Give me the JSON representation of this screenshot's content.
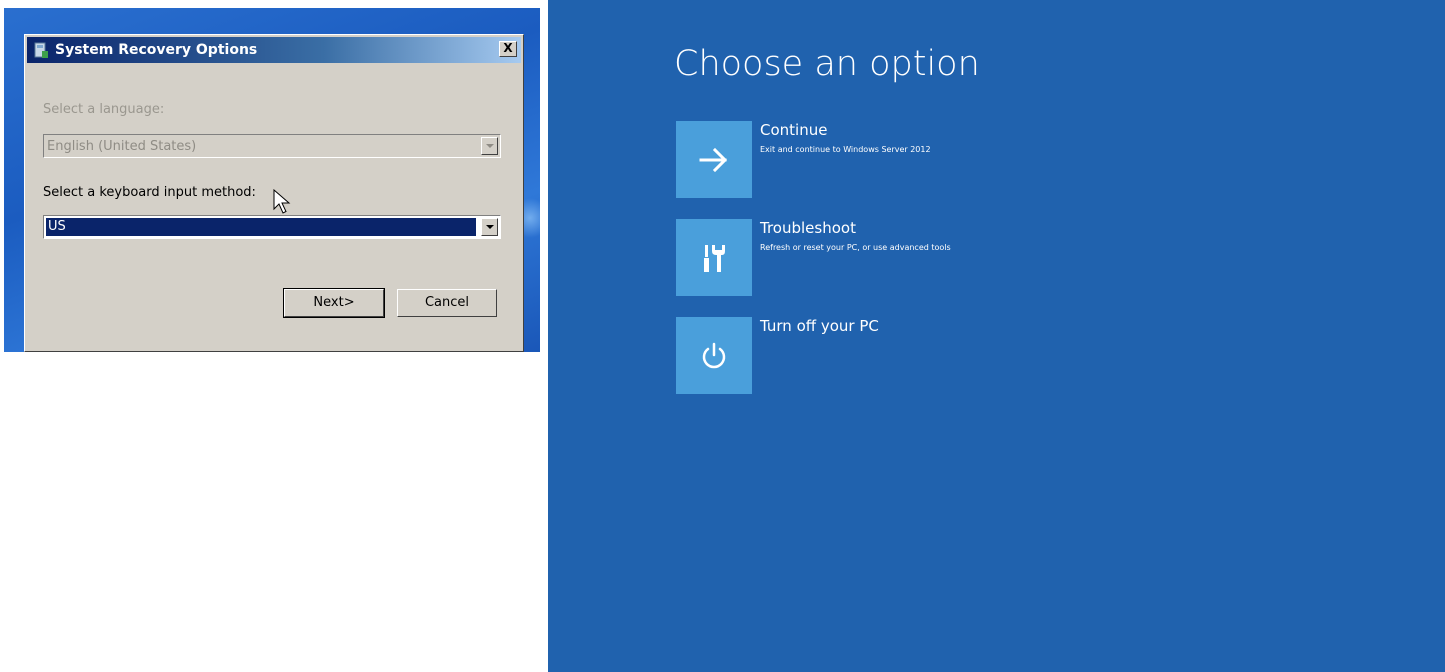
{
  "dialog": {
    "title": "System Recovery Options",
    "close_label": "X",
    "language_label": "Select a language:",
    "language_value": "English (United States)",
    "keyboard_label": "Select a keyboard input method:",
    "keyboard_value": "US",
    "next_label": "Next>",
    "cancel_label": "Cancel"
  },
  "recovery": {
    "title": "Choose an option",
    "background_color": "#2062ae",
    "tile_color": "#4a9fdb",
    "options": [
      {
        "title": "Continue",
        "description": "Exit and continue to Windows Server 2012",
        "icon": "arrow-right-icon"
      },
      {
        "title": "Troubleshoot",
        "description": "Refresh or reset your PC, or use advanced tools",
        "icon": "tools-icon"
      },
      {
        "title": "Turn off your PC",
        "description": "",
        "icon": "power-icon"
      }
    ]
  }
}
